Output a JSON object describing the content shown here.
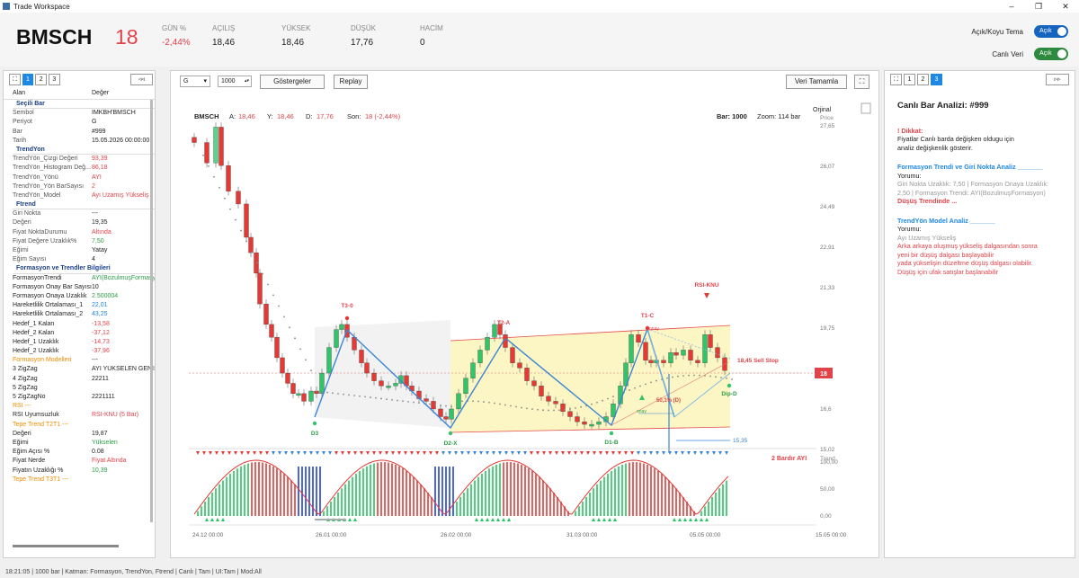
{
  "window": {
    "title": "Trade Workspace"
  },
  "header": {
    "symbol": "BMSCH",
    "price": "18",
    "stats": [
      {
        "label": "GÜN %",
        "value": "-2,44%",
        "red": true
      },
      {
        "label": "AÇILIŞ",
        "value": "18,46"
      },
      {
        "label": "YÜKSEK",
        "value": "18,46"
      },
      {
        "label": "DÜŞÜK",
        "value": "17,76"
      },
      {
        "label": "HACİM",
        "value": "0"
      }
    ],
    "theme_label": "Açık/Koyu Tema",
    "theme_value": "Açık",
    "live_label": "Canlı Veri",
    "live_value": "Açık"
  },
  "left": {
    "tabs": [
      "1",
      "2",
      "3"
    ],
    "active_tab": "1",
    "col_key": "Alan",
    "col_val": "Değer",
    "rows": [
      {
        "type": "section",
        "k": "Seçili Bar"
      },
      {
        "k": "Sembol",
        "v": "IMKBH'BMSCH"
      },
      {
        "k": "Periyot",
        "v": "G"
      },
      {
        "k": "Bar",
        "v": "#999"
      },
      {
        "k": "Tarih",
        "v": "15.05.2026 00:00:00"
      },
      {
        "type": "section",
        "k": "TrendYon"
      },
      {
        "k": "TrendYön_Çizgi Değeri",
        "v": "93,39",
        "c": "red"
      },
      {
        "k": "TrendYön_Histogram Değ...",
        "v": "86,18",
        "c": "red"
      },
      {
        "k": "TrendYön_Yönü",
        "v": "AYI",
        "c": "red"
      },
      {
        "k": "TrendYön_Yön BarSayısı",
        "v": "2",
        "c": "red"
      },
      {
        "k": "TrendYön_Model",
        "v": "Ayı Uzamış Yükseliş",
        "c": "red"
      },
      {
        "type": "section",
        "k": "Ftrend"
      },
      {
        "k": "Giri Nokta",
        "v": "---"
      },
      {
        "k": "Değeri",
        "v": "19,35"
      },
      {
        "k": "Fiyat NoktaDurumu",
        "v": "Altında",
        "c": "red"
      },
      {
        "k": "Fiyat Değere Uzaklık%",
        "v": "7,50",
        "c": "green"
      },
      {
        "k": "Eğimi",
        "v": "Yatay"
      },
      {
        "k": "Eğim Sayısı",
        "v": "4"
      },
      {
        "type": "section",
        "k": "Formasyon ve Trendler Bilgileri"
      },
      {
        "k": "FormasyonTrendi",
        "v": "AYI(BozulmuşFormasyo",
        "c": "green",
        "dark": true
      },
      {
        "k": "Formasyon Onay Bar Sayısı",
        "v": "10",
        "dark": true
      },
      {
        "k": "Formasyon Onaya Uzaklık",
        "v": "2.500004",
        "c": "green",
        "dark": true
      },
      {
        "k": "Hareketlilik Ortalaması_1",
        "v": "22,01",
        "c": "blue",
        "dark": true
      },
      {
        "k": "Hareketlilik Ortalaması_2",
        "v": "43,25",
        "c": "blue",
        "dark": true
      },
      {
        "k": "Hedef_1 Kalan",
        "v": "-13,58",
        "c": "red",
        "dark": true
      },
      {
        "k": "Hedef_2 Kalan",
        "v": "-37,12",
        "c": "red",
        "dark": true
      },
      {
        "k": "Hedef_1 Uzaklık",
        "v": "-14,73",
        "c": "red",
        "dark": true
      },
      {
        "k": "Hedef_2 Uzaklık",
        "v": "-37,96",
        "c": "red",
        "dark": true
      },
      {
        "k": "Formasyon Modelleri",
        "v": "---",
        "korange": true
      },
      {
        "k": "3 ZigZag",
        "v": "AYI YÜKSELEN GENİŞ",
        "dark": true
      },
      {
        "k": "4 ZigZag",
        "v": "22211",
        "dark": true
      },
      {
        "k": "5 ZigZag",
        "v": "",
        "dark": true
      },
      {
        "k": "5 ZigZagNo",
        "v": "2221111",
        "dark": true
      },
      {
        "k": "RSI ---",
        "v": "",
        "korange": true
      },
      {
        "k": "RSI Uyumsuzluk",
        "v": "RSI-KNU (5 Bar)",
        "c": "red",
        "dark": true
      },
      {
        "k": "Tepe Trend T2T1 ---",
        "v": "",
        "korange": true
      },
      {
        "k": "Değeri",
        "v": "19,87",
        "dark": true
      },
      {
        "k": "Eğimi",
        "v": "Yükselen",
        "c": "green",
        "dark": true
      },
      {
        "k": "Eğim Açısı %",
        "v": "0.08",
        "dark": true
      },
      {
        "k": "Fiyat Nerde",
        "v": "Fiyat Altında",
        "c": "red",
        "dark": true
      },
      {
        "k": "Fiyatın Uzaklığı %",
        "v": "10,39",
        "c": "green",
        "dark": true
      },
      {
        "k": "Tepe Trend T3T1 ---",
        "v": "",
        "korange": true
      }
    ]
  },
  "chart": {
    "period": "G",
    "bars_input": "1000",
    "indicators_label": "Göstergeler",
    "replay_label": "Replay",
    "complete_label": "Veri Tamamla",
    "info": {
      "sym": "BMSCH",
      "a_lbl": "A:",
      "a": "18,46",
      "y_lbl": "Y:",
      "y": "18,46",
      "d_lbl": "D:",
      "d": "17,76",
      "son_lbl": "Son:",
      "son": "18 (-2,44%)"
    },
    "bar_info": "Bar: 1000",
    "zoom_info": "Zoom: 114 bar",
    "scale_mode": "Orjinal",
    "price_axis_title": "Price",
    "price_ticks": [
      "27,65",
      "26,07",
      "24,49",
      "22,91",
      "21,33",
      "19,75",
      "16,6",
      "15,02"
    ],
    "last_price_tag": "18",
    "sell_stop": "18,45 Sell Stop",
    "labels": {
      "t3": "T3-0",
      "t2": "T2-A",
      "t1": "T1-C",
      "rsi": "RSI-KNU",
      "d3": "D3",
      "d2": "D2-X",
      "d1": "D1-B",
      "dip": "Dip-D",
      "fib": "50,1% (D)",
      "onay": "onay",
      "level": "15,35"
    },
    "osc_title": "Trend",
    "osc_ticks": [
      "100,00",
      "50,00",
      "0,00"
    ],
    "osc_note": "2 Bardır AYI",
    "date_ticks": [
      "24.12 00:00",
      "26.01 00:00",
      "26.02 00:00",
      "31.03 00:00",
      "05.05 00:00",
      "15.05 00:00"
    ]
  },
  "right": {
    "tabs": [
      "1",
      "2",
      "3"
    ],
    "active_tab": "3",
    "title": "Canlı Bar Analizi: #999",
    "warn_title": "! Dikkat:",
    "warn_text": [
      "Fiyatlar Canlı barda değişken oldugu için",
      "analiz değişkenlik gösterir."
    ],
    "sec1_title": "Formasyon Trendi ve Giri Nokta Analiz _______",
    "sec1_sub": "Yorumu:",
    "sec1_lines": [
      "Giri Nokta Uzaklık: 7,50 | Formasyon Onaya Uzaklık:",
      "2,50 | Formasyon Trendi: AYI(BozulmuşFormasyon)"
    ],
    "sec1_red": "Düşüş Trendinde ...",
    "sec2_title": "TrendYön Model Analiz _______",
    "sec2_sub": "Yorumu:",
    "sec2_grey": "Ayı Uzamış Yükseliş",
    "sec2_red": [
      "Arka arkaya oluşmuş yükseliş dalgasından sonra",
      "yeni bir düşüş dalgası başlayabilir",
      "yada yükselişin düzeltme düşüş dalgası olabilir.",
      "Düşüş için ufak satışlar başlanabilir"
    ]
  },
  "status": "18:21:05 | 1000 bar | Katman: Formasyon, TrendYon, Ftrend | Canlı | Tam | UI:Tam | Mod:All"
}
